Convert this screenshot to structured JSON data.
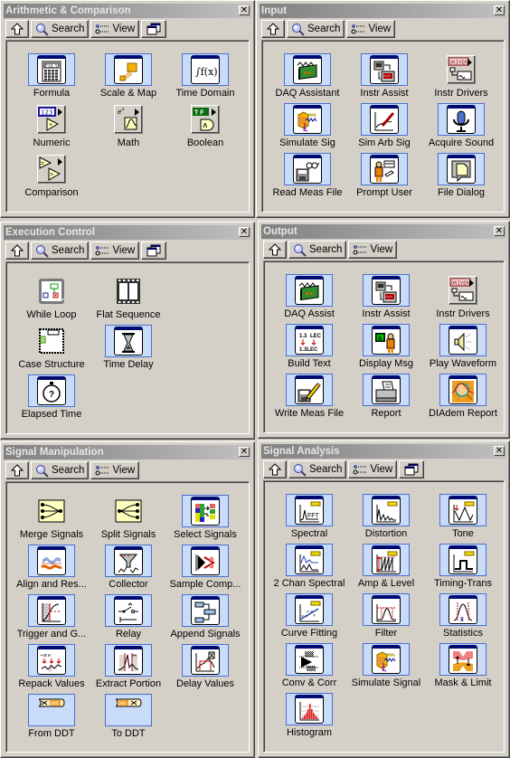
{
  "toolbar": {
    "up_label": "",
    "search_label": "Search",
    "view_label": "View"
  },
  "palettes": [
    {
      "title": "Arithmetic & Comparison",
      "has_newwin": true,
      "items": [
        {
          "label": "Formula",
          "icon": "calculator-icon",
          "style": "sel"
        },
        {
          "label": "Scale & Map",
          "icon": "scale-map-icon",
          "style": "sel"
        },
        {
          "label": "Time Domain",
          "icon": "integral-icon",
          "style": "sel"
        },
        {
          "label": "Numeric",
          "icon": "numeric-icon",
          "style": "sub"
        },
        {
          "label": "Math",
          "icon": "math-icon",
          "style": "sub"
        },
        {
          "label": "Boolean",
          "icon": "boolean-icon",
          "style": "sub"
        },
        {
          "label": "Comparison",
          "icon": "comparison-icon",
          "style": "sub"
        }
      ]
    },
    {
      "title": "Input",
      "has_newwin": false,
      "items": [
        {
          "label": "DAQ Assistant",
          "icon": "daq-card-icon",
          "style": "sel"
        },
        {
          "label": "Instr Assist",
          "icon": "instrument-icon",
          "style": "sel"
        },
        {
          "label": "Instr Drivers",
          "icon": "drivers-icon",
          "style": "sub"
        },
        {
          "label": "Simulate Sig",
          "icon": "simulate-signal-icon",
          "style": "sel"
        },
        {
          "label": "Sim Arb Sig",
          "icon": "pen-graph-icon",
          "style": "sel"
        },
        {
          "label": "Acquire Sound",
          "icon": "microphone-icon",
          "style": "sel"
        },
        {
          "label": "Read Meas File",
          "icon": "read-file-icon",
          "style": "sel"
        },
        {
          "label": "Prompt User",
          "icon": "person-dialog-icon",
          "style": "sel"
        },
        {
          "label": "File Dialog",
          "icon": "file-dialog-icon",
          "style": "sel"
        }
      ]
    },
    {
      "title": "Execution Control",
      "has_newwin": true,
      "items": [
        {
          "label": "While Loop",
          "icon": "while-loop-icon",
          "style": "plain"
        },
        {
          "label": "Flat Sequence",
          "icon": "film-sequence-icon",
          "style": "plain"
        },
        {
          "label": "",
          "icon": "",
          "style": "none"
        },
        {
          "label": "Case Structure",
          "icon": "case-structure-icon",
          "style": "plain"
        },
        {
          "label": "Time Delay",
          "icon": "hourglass-icon",
          "style": "sel"
        },
        {
          "label": "",
          "icon": "",
          "style": "none"
        },
        {
          "label": "Elapsed Time",
          "icon": "stopwatch-icon",
          "style": "sel"
        }
      ]
    },
    {
      "title": "Output",
      "has_newwin": false,
      "items": [
        {
          "label": "DAQ Assist",
          "icon": "daq-card-icon",
          "style": "sel"
        },
        {
          "label": "Instr Assist",
          "icon": "instrument-icon",
          "style": "sel"
        },
        {
          "label": "Instr Drivers",
          "icon": "drivers-icon",
          "style": "sub"
        },
        {
          "label": "Build Text",
          "icon": "build-text-icon",
          "style": "sel"
        },
        {
          "label": "Display Msg",
          "icon": "display-message-icon",
          "style": "sel"
        },
        {
          "label": "Play Waveform",
          "icon": "speaker-icon",
          "style": "sel"
        },
        {
          "label": "Write Meas File",
          "icon": "write-file-icon",
          "style": "sel"
        },
        {
          "label": "Report",
          "icon": "printer-icon",
          "style": "sel"
        },
        {
          "label": "DIAdem Report",
          "icon": "diadem-icon",
          "style": "sel"
        }
      ]
    },
    {
      "title": "Signal Manipulation",
      "has_newwin": false,
      "items": [
        {
          "label": "Merge Signals",
          "icon": "merge-icon",
          "style": "plain"
        },
        {
          "label": "Split Signals",
          "icon": "split-icon",
          "style": "plain"
        },
        {
          "label": "Select Signals",
          "icon": "select-signals-icon",
          "style": "sel"
        },
        {
          "label": "Align and Res...",
          "icon": "align-resample-icon",
          "style": "sel"
        },
        {
          "label": "Collector",
          "icon": "funnel-icon",
          "style": "sel"
        },
        {
          "label": "Sample Comp...",
          "icon": "sample-compression-icon",
          "style": "sel"
        },
        {
          "label": "Trigger and G...",
          "icon": "trigger-gate-icon",
          "style": "sel"
        },
        {
          "label": "Relay",
          "icon": "relay-switch-icon",
          "style": "sel"
        },
        {
          "label": "Append Signals",
          "icon": "append-signals-icon",
          "style": "sel"
        },
        {
          "label": "Repack Values",
          "icon": "repack-icon",
          "style": "sel"
        },
        {
          "label": "Extract Portion",
          "icon": "scissors-graph-icon",
          "style": "sel"
        },
        {
          "label": "Delay Values",
          "icon": "delay-graph-icon",
          "style": "sel"
        },
        {
          "label": "From DDT",
          "icon": "from-ddt-icon",
          "style": "ddt"
        },
        {
          "label": "To DDT",
          "icon": "to-ddt-icon",
          "style": "ddt"
        }
      ]
    },
    {
      "title": "Signal Analysis",
      "has_newwin": true,
      "items": [
        {
          "label": "Spectral",
          "icon": "fft-icon",
          "style": "sel"
        },
        {
          "label": "Distortion",
          "icon": "distortion-icon",
          "style": "sel"
        },
        {
          "label": "Tone",
          "icon": "tone-icon",
          "style": "sel"
        },
        {
          "label": "2 Chan Spectral",
          "icon": "two-chan-spectral-icon",
          "style": "sel"
        },
        {
          "label": "Amp & Level",
          "icon": "amp-level-icon",
          "style": "sel"
        },
        {
          "label": "Timing-Trans",
          "icon": "pulse-icon",
          "style": "sel"
        },
        {
          "label": "Curve Fitting",
          "icon": "curve-fit-icon",
          "style": "sel"
        },
        {
          "label": "Filter",
          "icon": "filter-icon",
          "style": "sel"
        },
        {
          "label": "Statistics",
          "icon": "statistics-icon",
          "style": "sel"
        },
        {
          "label": "Conv & Corr",
          "icon": "convolution-icon",
          "style": "sel"
        },
        {
          "label": "Simulate Signal",
          "icon": "simulate-signal-icon",
          "style": "sel"
        },
        {
          "label": "Mask & Limit",
          "icon": "mask-limit-icon",
          "style": "sel"
        },
        {
          "label": "Histogram",
          "icon": "histogram-icon",
          "style": "sel"
        }
      ]
    }
  ]
}
